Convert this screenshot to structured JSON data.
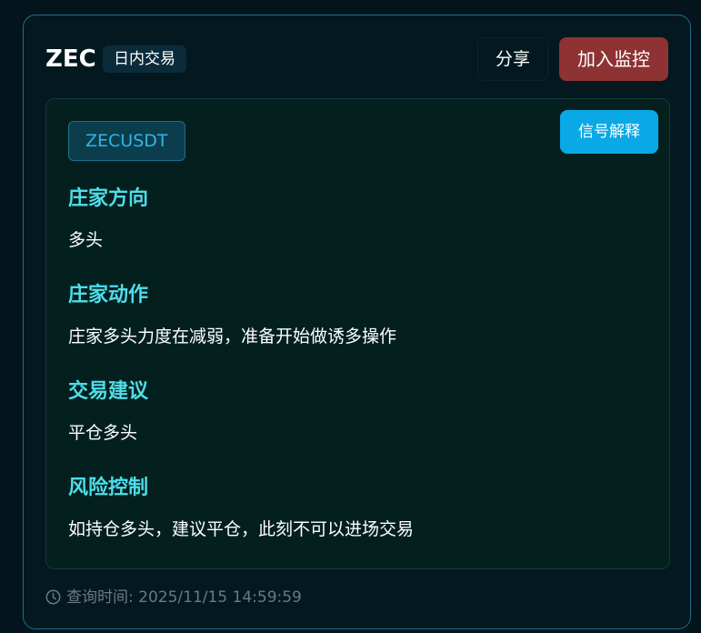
{
  "header": {
    "symbol": "ZEC",
    "mode_tag": "日内交易",
    "share_label": "分享",
    "watch_label": "加入监控"
  },
  "panel": {
    "pair": "ZECUSDT",
    "explain_label": "信号解释",
    "sections": [
      {
        "title": "庄家方向",
        "text": "多头"
      },
      {
        "title": "庄家动作",
        "text": "庄家多头力度在减弱，准备开始做诱多操作"
      },
      {
        "title": "交易建议",
        "text": "平仓多头"
      },
      {
        "title": "风险控制",
        "text": "如持仓多头，建议平仓，此刻不可以进场交易"
      }
    ]
  },
  "footer": {
    "icon": "clock-icon",
    "query_time": "查询时间: 2025/11/15 14:59:59"
  },
  "colors": {
    "accent_title": "#4fdde9",
    "watch_button": "#8f3234",
    "explain_button": "#0aa8e6",
    "pair_text": "#2fb6e6"
  }
}
